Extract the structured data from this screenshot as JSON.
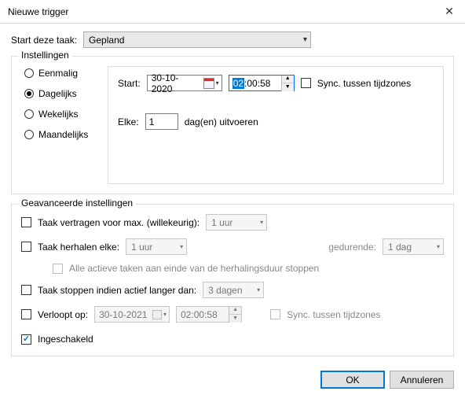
{
  "window": {
    "title": "Nieuwe trigger"
  },
  "begin": {
    "label": "Start deze taak:",
    "value": "Gepland"
  },
  "settings": {
    "legend": "Instellingen",
    "radios": {
      "once": "Eenmalig",
      "daily": "Dagelijks",
      "weekly": "Wekelijks",
      "monthly": "Maandelijks"
    },
    "start_label": "Start:",
    "start_date": "30-10-2020",
    "start_time_sel": "02",
    "start_time_rest": ":00:58",
    "sync_label": "Sync. tussen tijdzones",
    "every_label": "Elke:",
    "every_value": "1",
    "every_suffix": "dag(en) uitvoeren"
  },
  "advanced": {
    "legend": "Geavanceerde instellingen",
    "delay_label": "Taak vertragen voor max. (willekeurig):",
    "delay_value": "1 uur",
    "repeat_label": "Taak herhalen elke:",
    "repeat_value": "1 uur",
    "duration_label": "gedurende:",
    "duration_value": "1 dag",
    "stop_all_label": "Alle actieve taken aan einde van de herhalingsduur stoppen",
    "stop_if_label": "Taak stoppen indien actief langer dan:",
    "stop_if_value": "3 dagen",
    "expire_label": "Verloopt op:",
    "expire_date": "30-10-2021",
    "expire_time": "02:00:58",
    "expire_sync_label": "Sync. tussen tijdzones",
    "enabled_label": "Ingeschakeld"
  },
  "buttons": {
    "ok": "OK",
    "cancel": "Annuleren"
  }
}
